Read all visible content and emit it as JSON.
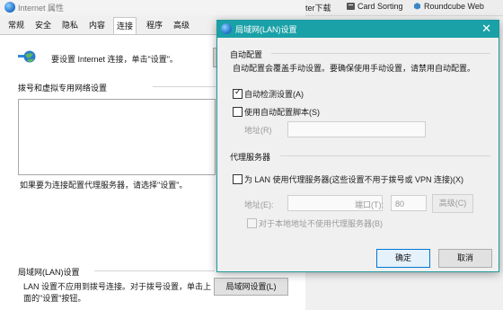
{
  "window_title": "Internet 属性",
  "bookmarks": [
    {
      "label": "ter下载"
    },
    {
      "label": "Card Sorting",
      "icon": "card-sorting-icon"
    },
    {
      "label": "Roundcube Web",
      "icon": "roundcube-icon"
    }
  ],
  "tabs": [
    "常规",
    "安全",
    "隐私",
    "内容",
    "连接",
    "程序",
    "高级"
  ],
  "active_tab": "连接",
  "connections": {
    "setup_text": "要设置 Internet 连接，单击\"设置\"。",
    "dialup_heading": "拨号和虚拟专用网络设置",
    "proxy_hint": "如果要为连接配置代理服务器，请选择\"设置\"。",
    "lan_heading": "局域网(LAN)设置",
    "lan_desc_line1": "LAN 设置不应用到拨号连接。对于拨号设置，单击上",
    "lan_desc_line2": "面的\"设置\"按钮。",
    "lan_button": "局域网设置(L)"
  },
  "lan_dialog": {
    "title": "局域网(LAN)设置",
    "close_icon": "close-icon",
    "auto_config": {
      "heading": "自动配置",
      "desc": "自动配置会覆盖手动设置。要确保使用手动设置，请禁用自动配置。",
      "auto_detect_label": "自动检测设置(A)",
      "auto_detect_checked": true,
      "use_script_label": "使用自动配置脚本(S)",
      "use_script_checked": false,
      "address_label": "地址(R)",
      "address_value": ""
    },
    "proxy": {
      "heading": "代理服务器",
      "use_proxy_label": "为 LAN 使用代理服务器(这些设置不用于拨号或 VPN 连接)(X)",
      "use_proxy_checked": false,
      "address_label": "地址(E):",
      "address_value": "",
      "port_label": "端口(T):",
      "port_value": "80",
      "advanced_button": "高级(C)",
      "bypass_label": "对于本地地址不使用代理服务器(B)",
      "bypass_checked": false
    },
    "ok_button": "确定",
    "cancel_button": "取消"
  }
}
